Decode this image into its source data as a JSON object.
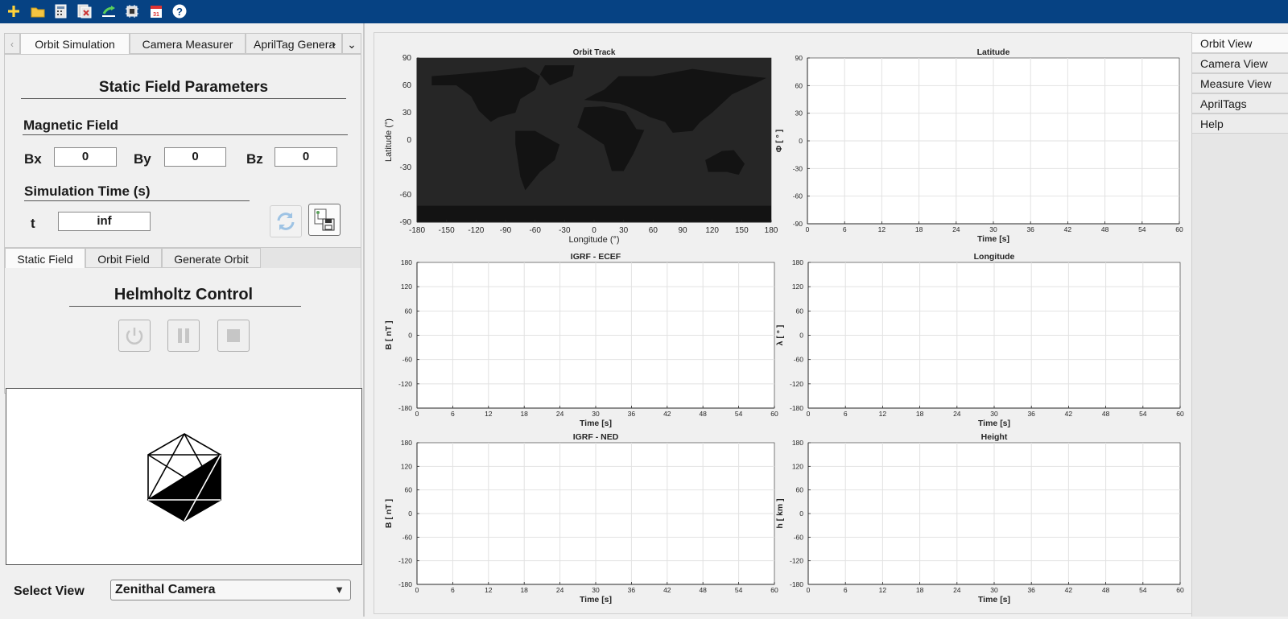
{
  "toolbar": {
    "icons": [
      "add-icon",
      "open-folder-icon",
      "calculator-icon",
      "calculator-copy-icon",
      "export-icon",
      "chip-icon",
      "calendar-icon",
      "help-icon"
    ],
    "bg_color": "#064283"
  },
  "left_tabs": {
    "items": [
      "Orbit Simulation",
      "Camera Measurer",
      "AprilTag Genera"
    ],
    "active": "Orbit Simulation"
  },
  "static_field": {
    "title": "Static Field Parameters",
    "magnetic_field_label": "Magnetic Field",
    "bx_label": "Bx",
    "bx_value": "0",
    "by_label": "By",
    "by_value": "0",
    "bz_label": "Bz",
    "bz_value": "0",
    "sim_time_label": "Simulation Time (s)",
    "t_label": "t",
    "t_value": "inf"
  },
  "field_tabs": {
    "items": [
      "Static Field",
      "Orbit Field",
      "Generate Orbit"
    ],
    "active": "Static Field"
  },
  "helmholtz": {
    "title": "Helmholtz Control"
  },
  "select_view": {
    "label": "Select View",
    "value": "Zenithal Camera"
  },
  "right_tabs": {
    "items": [
      "Orbit View",
      "Camera View",
      "Measure View",
      "AprilTags",
      "Help"
    ],
    "active": "Orbit View"
  },
  "chart_data": [
    {
      "type": "line",
      "title": "Orbit Track",
      "xlabel": "Longitude (°)",
      "ylabel": "Latitude (°)",
      "xlim": [
        -180,
        180
      ],
      "ylim": [
        -90,
        90
      ],
      "xticks": [
        "-180",
        "-150",
        "-120",
        "-90",
        "-60",
        "-30",
        "0",
        "30",
        "60",
        "90",
        "120",
        "150",
        "180"
      ],
      "yticks": [
        "90",
        "60",
        "30",
        "0",
        "-30",
        "-60",
        "-90"
      ],
      "background": "world-map",
      "series": []
    },
    {
      "type": "line",
      "title": "Latitude",
      "xlabel": "Time [s]",
      "ylabel": "Φ [ ° ]",
      "xlim": [
        0,
        60
      ],
      "ylim": [
        -90,
        90
      ],
      "xticks": [
        "0",
        "6",
        "12",
        "18",
        "24",
        "30",
        "36",
        "42",
        "48",
        "54",
        "60"
      ],
      "yticks": [
        "90",
        "60",
        "30",
        "0",
        "-30",
        "-60",
        "-90"
      ],
      "grid": true,
      "series": []
    },
    {
      "type": "line",
      "title": "IGRF - ECEF",
      "xlabel": "Time [s]",
      "ylabel": "B [ nT ]",
      "xlim": [
        0,
        60
      ],
      "ylim": [
        -180,
        180
      ],
      "xticks": [
        "0",
        "6",
        "12",
        "18",
        "24",
        "30",
        "36",
        "42",
        "48",
        "54",
        "60"
      ],
      "yticks": [
        "180",
        "120",
        "60",
        "0",
        "-60",
        "-120",
        "-180"
      ],
      "grid": true,
      "series": []
    },
    {
      "type": "line",
      "title": "Longitude",
      "xlabel": "Time [s]",
      "ylabel": "λ [ ° ]",
      "xlim": [
        0,
        60
      ],
      "ylim": [
        -180,
        180
      ],
      "xticks": [
        "0",
        "6",
        "12",
        "18",
        "24",
        "30",
        "36",
        "42",
        "48",
        "54",
        "60"
      ],
      "yticks": [
        "180",
        "120",
        "60",
        "0",
        "-60",
        "-120",
        "-180"
      ],
      "grid": true,
      "series": []
    },
    {
      "type": "line",
      "title": "IGRF - NED",
      "xlabel": "Time [s]",
      "ylabel": "B [ nT ]",
      "xlim": [
        0,
        60
      ],
      "ylim": [
        -180,
        180
      ],
      "xticks": [
        "0",
        "6",
        "12",
        "18",
        "24",
        "30",
        "36",
        "42",
        "48",
        "54",
        "60"
      ],
      "yticks": [
        "180",
        "120",
        "60",
        "0",
        "-60",
        "-120",
        "-180"
      ],
      "grid": true,
      "series": []
    },
    {
      "type": "line",
      "title": "Height",
      "xlabel": "Time [s]",
      "ylabel": "h [ km ]",
      "xlim": [
        0,
        60
      ],
      "ylim": [
        -180,
        180
      ],
      "xticks": [
        "0",
        "6",
        "12",
        "18",
        "24",
        "30",
        "36",
        "42",
        "48",
        "54",
        "60"
      ],
      "yticks": [
        "180",
        "120",
        "60",
        "0",
        "-60",
        "-120",
        "-180"
      ],
      "grid": true,
      "series": []
    }
  ]
}
